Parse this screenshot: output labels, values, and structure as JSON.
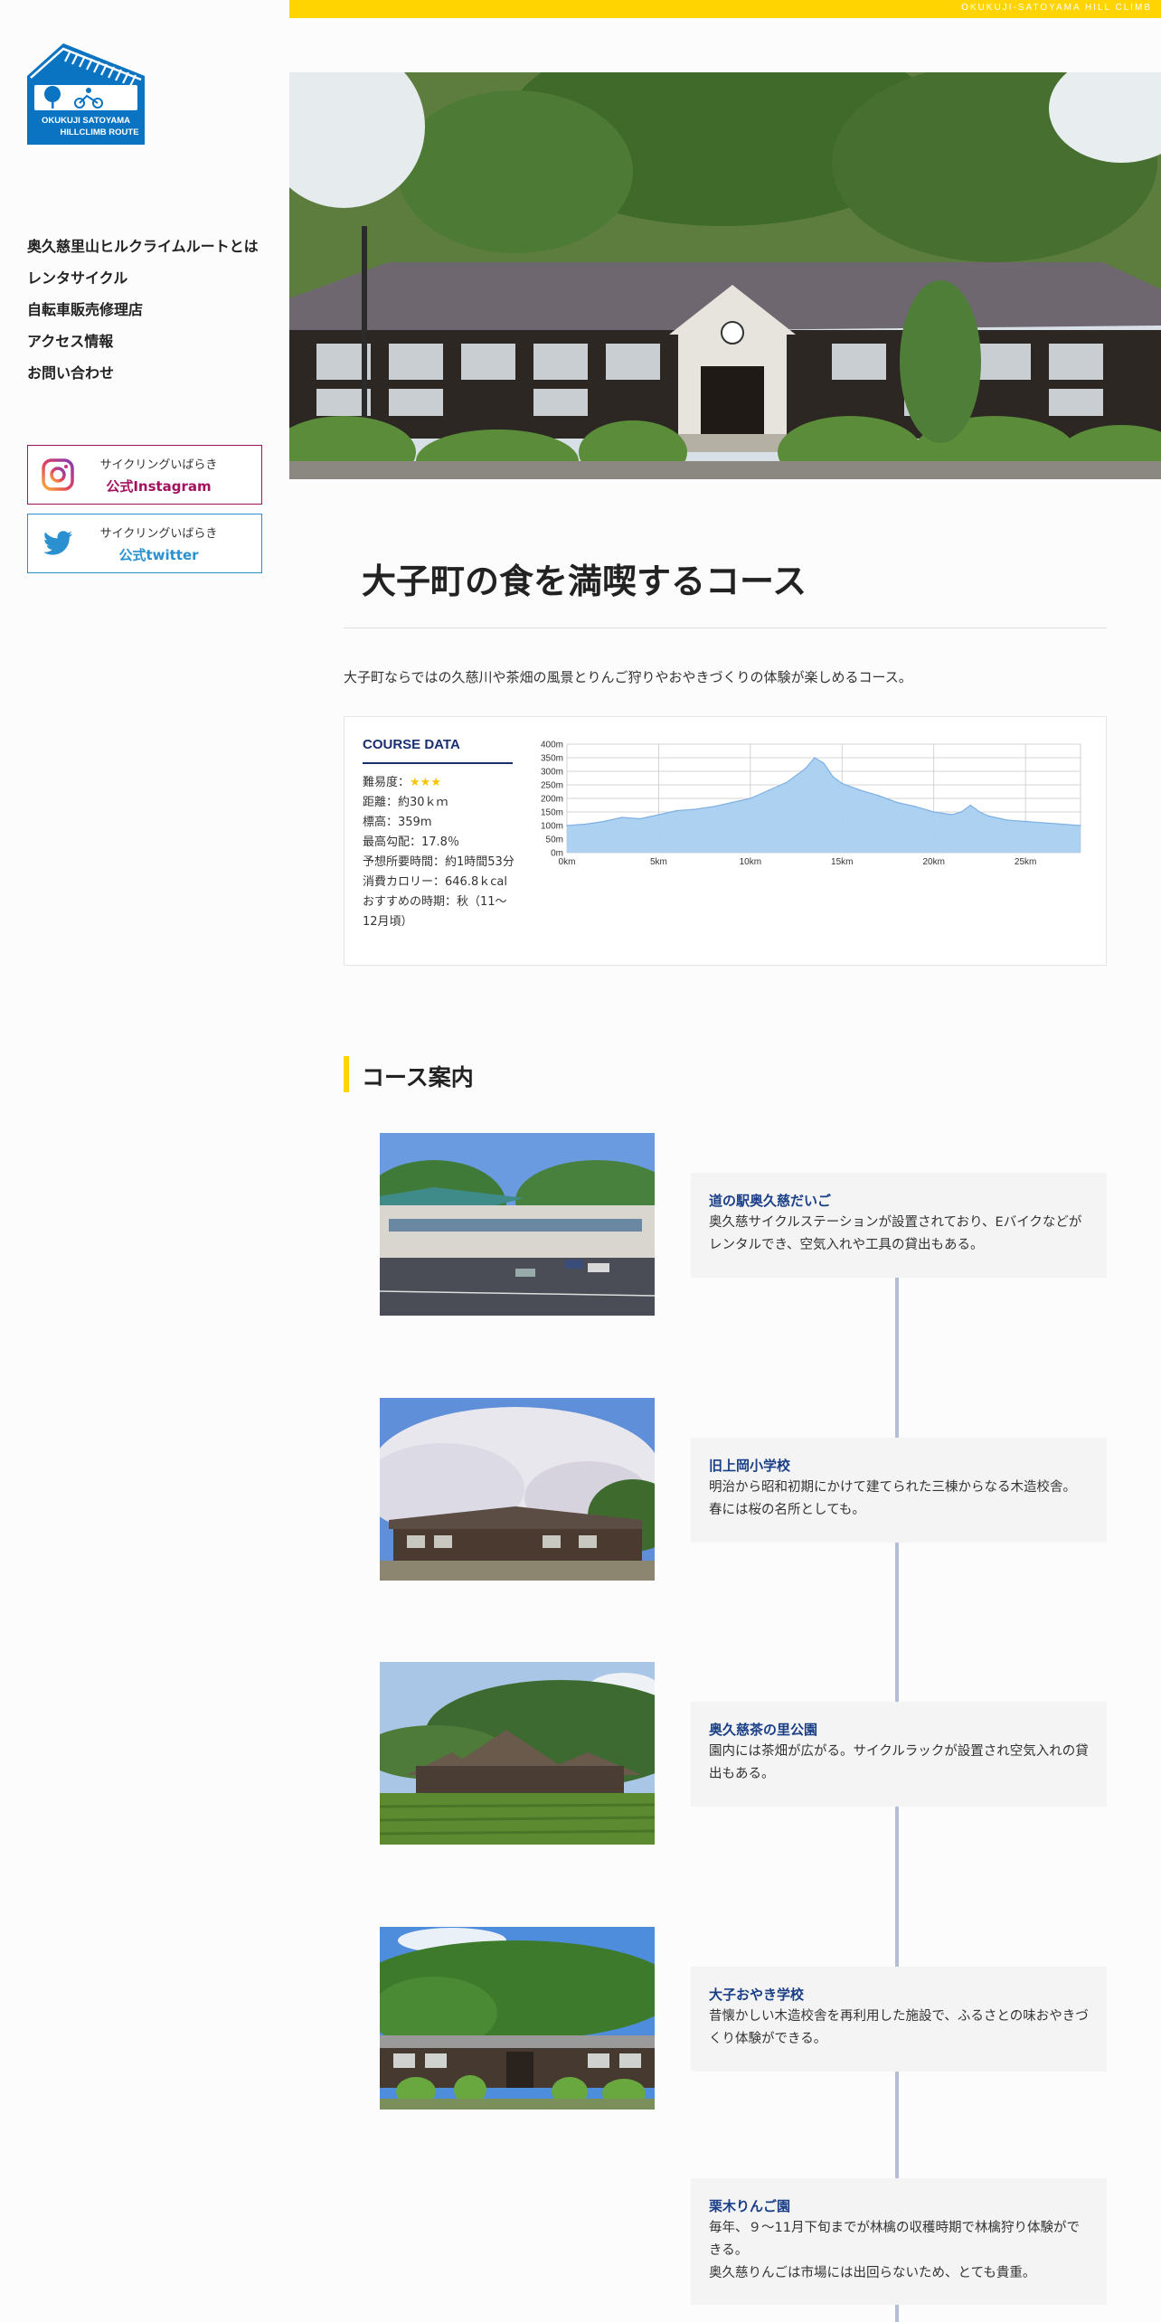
{
  "topbar": {
    "tagline": "OKUKUJI-SATOYAMA HILL CLIMB"
  },
  "logo": {
    "text_line1": "OKUKUJI SATOYAMA",
    "text_line2": "HILLCLIMB ROUTE",
    "color": "#0b74c2"
  },
  "nav": {
    "items": [
      {
        "label": "奥久慈里山ヒルクライムルートとは"
      },
      {
        "label": "レンタサイクル"
      },
      {
        "label": "自転車販売修理店"
      },
      {
        "label": "アクセス情報"
      },
      {
        "label": "お問い合わせ"
      }
    ]
  },
  "social": {
    "instagram": {
      "sub": "サイクリングいばらき",
      "main": "公式Instagram",
      "icon": "instagram-icon",
      "color": "#a3125e"
    },
    "twitter": {
      "sub": "サイクリングいばらき",
      "main": "公式twitter",
      "icon": "twitter-icon",
      "color": "#2a90cf"
    }
  },
  "course": {
    "title": "大子町の食を満喫するコース",
    "intro": "大子町ならではの久慈川や茶畑の風景とりんご狩りやおやきづくりの体験が楽しめるコース。"
  },
  "course_data": {
    "heading": "COURSE DATA",
    "difficulty_label": "難易度：",
    "difficulty_stars": "★★★",
    "distance": "距離：約30ｋｍ",
    "elevation": "標高：359m",
    "max_grade": "最高勾配：17.8％",
    "time": "予想所要時間：約1時間53分",
    "calories": "消費カロリー：646.8ｋcal",
    "season": "おすすめの時期：秋（11～12月頃）"
  },
  "chart_data": {
    "type": "area",
    "title": "",
    "xlabel": "",
    "ylabel": "",
    "x_ticks": [
      "0km",
      "5km",
      "10km",
      "15km",
      "20km",
      "25km"
    ],
    "y_ticks": [
      "400m",
      "350m",
      "300m",
      "250m",
      "200m",
      "150m",
      "100m",
      "50m",
      "0m"
    ],
    "xlim": [
      0,
      28
    ],
    "ylim": [
      0,
      400
    ],
    "grid": true,
    "fill_color": "#a9cff0",
    "line_color": "#7fb2e3",
    "x": [
      0,
      1,
      2,
      3,
      4,
      5,
      6,
      7,
      8,
      9,
      10,
      11,
      12,
      13,
      13.5,
      14,
      14.5,
      15,
      16,
      17,
      18,
      19,
      20,
      21,
      21.5,
      22,
      22.5,
      23,
      24,
      25,
      26,
      27,
      28
    ],
    "y": [
      100,
      105,
      115,
      130,
      125,
      140,
      155,
      160,
      170,
      185,
      200,
      230,
      260,
      310,
      350,
      330,
      280,
      255,
      230,
      210,
      185,
      170,
      150,
      140,
      150,
      175,
      150,
      135,
      120,
      115,
      110,
      105,
      100
    ]
  },
  "guide": {
    "title": "コース案内",
    "stops": [
      {
        "name": "道の駅奥久慈だいご",
        "desc": "奥久慈サイクルステーションが設置されており、Eバイクなどがレンタルでき、空気入れや工具の貸出もある。"
      },
      {
        "name": "旧上岡小学校",
        "desc": "明治から昭和初期にかけて建てられた三棟からなる木造校舎。春には桜の名所としても。"
      },
      {
        "name": "奥久慈茶の里公園",
        "desc": "園内には茶畑が広がる。サイクルラックが設置され空気入れの貸出もある。"
      },
      {
        "name": "大子おやき学校",
        "desc": "昔懐かしい木造校舎を再利用した施設で、ふるさとの味おやきづくり体験ができる。"
      },
      {
        "name": "栗木りんご園",
        "desc": "毎年、９～11月下旬までが林檎の収穫時期で林檎狩り体験ができる。",
        "desc2": "奥久慈りんごは市場には出回らないため、とても貴重。"
      }
    ]
  }
}
